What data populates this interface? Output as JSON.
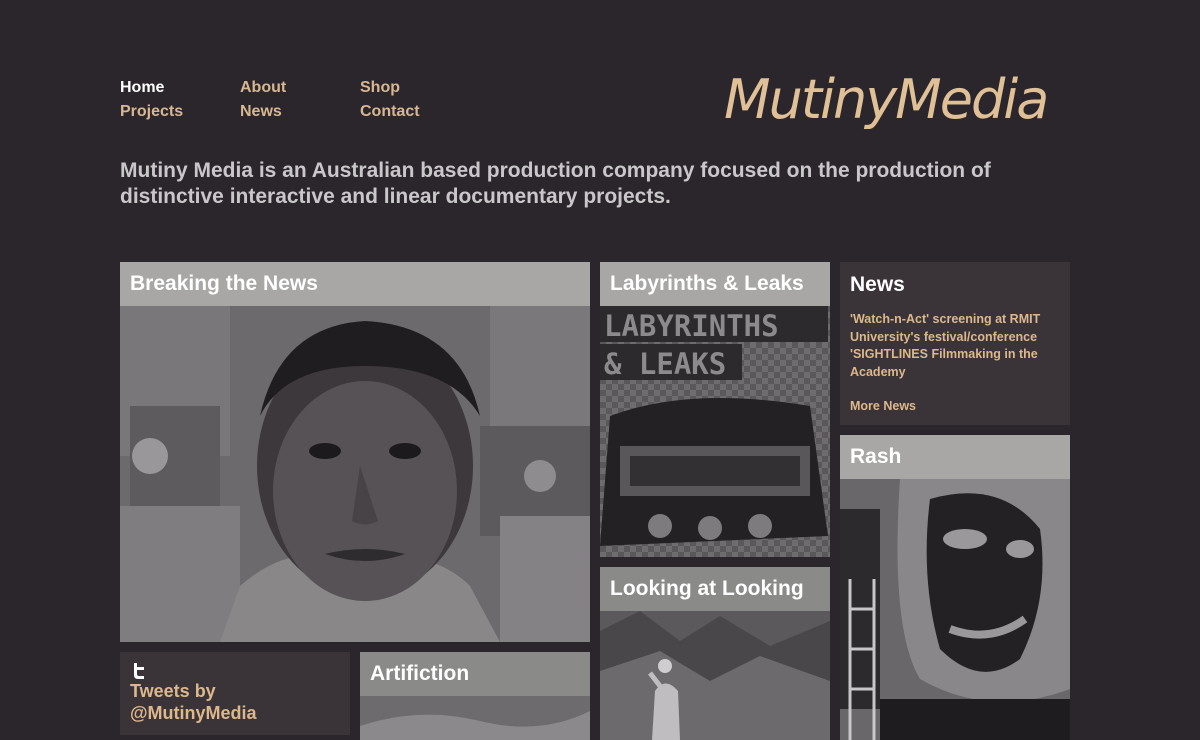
{
  "nav": {
    "home": "Home",
    "about": "About",
    "shop": "Shop",
    "projects": "Projects",
    "news": "News",
    "contact": "Contact"
  },
  "logo": {
    "text": "MutinyMedia",
    "color": "#e0c096"
  },
  "tagline": "Mutiny Media is an Australian based production company focused on the production of distinctive interactive and linear documentary projects.",
  "tiles": {
    "breaking_news": {
      "title": "Breaking the News"
    },
    "labyrinths": {
      "title": "Labyrinths & Leaks",
      "art_line1": "LABYRINTHS",
      "art_line2": "& LEAKS"
    },
    "looking": {
      "title": "Looking at Looking"
    },
    "rash": {
      "title": "Rash"
    },
    "artifiction": {
      "title": "Artifiction"
    }
  },
  "news_panel": {
    "heading": "News",
    "item": "'Watch-n-Act' screening at RMIT University's festival/conference 'SIGHTLINES Filmmaking in the Academy",
    "more": "More News"
  },
  "tweets": {
    "icon": "twitter-icon",
    "label_line1": "Tweets by",
    "label_line2": "@MutinyMedia"
  },
  "colors": {
    "background": "#2b262c",
    "accent": "#dcb88c",
    "title_bar": "#a8a7a5",
    "panel": "#3a3439"
  }
}
